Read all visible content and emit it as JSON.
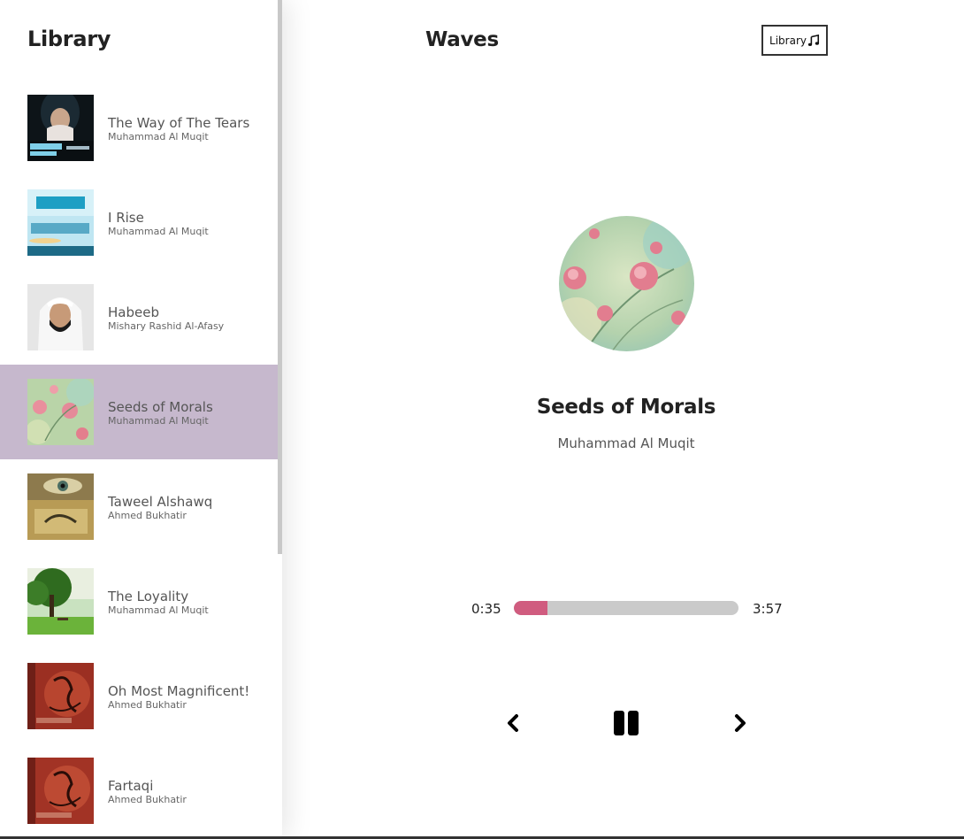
{
  "sidebar": {
    "title": "Library",
    "songs": [
      {
        "name": "The Way of The Tears",
        "artist": "Muhammad Al Muqit",
        "cover": "way-of-tears-cover",
        "selected": false
      },
      {
        "name": "I Rise",
        "artist": "Muhammad Al Muqit",
        "cover": "i-rise-cover",
        "selected": false
      },
      {
        "name": "Habeeb",
        "artist": "Mishary Rashid Al-Afasy",
        "cover": "habeeb-cover",
        "selected": false
      },
      {
        "name": "Seeds of Morals",
        "artist": "Muhammad Al Muqit",
        "cover": "seeds-of-morals-cover",
        "selected": true
      },
      {
        "name": "Taweel Alshawq",
        "artist": "Ahmed Bukhatir",
        "cover": "taweel-alshawq-cover",
        "selected": false
      },
      {
        "name": "The Loyality",
        "artist": "Muhammad Al Muqit",
        "cover": "loyality-cover",
        "selected": false
      },
      {
        "name": "Oh Most Magnificent!",
        "artist": "Ahmed Bukhatir",
        "cover": "oh-most-magnificent-cover",
        "selected": false
      },
      {
        "name": "Fartaqi",
        "artist": "Ahmed Bukhatir",
        "cover": "fartaqi-cover",
        "selected": false
      }
    ]
  },
  "header": {
    "title": "Waves",
    "library_button_label": "Library",
    "library_button_icon": "music-note-icon"
  },
  "player": {
    "song_title": "Seeds of Morals",
    "artist": "Muhammad Al Muqit",
    "current_time": "0:35",
    "duration": "3:57",
    "progress_fraction": 0.15,
    "controls": {
      "prev_icon": "chevron-left-icon",
      "pause_icon": "pause-icon",
      "next_icon": "chevron-right-icon"
    }
  },
  "colors": {
    "selected_row": "#c6b8cd",
    "progress_fill": "#d05c7f",
    "progress_track": "#cacaca"
  }
}
